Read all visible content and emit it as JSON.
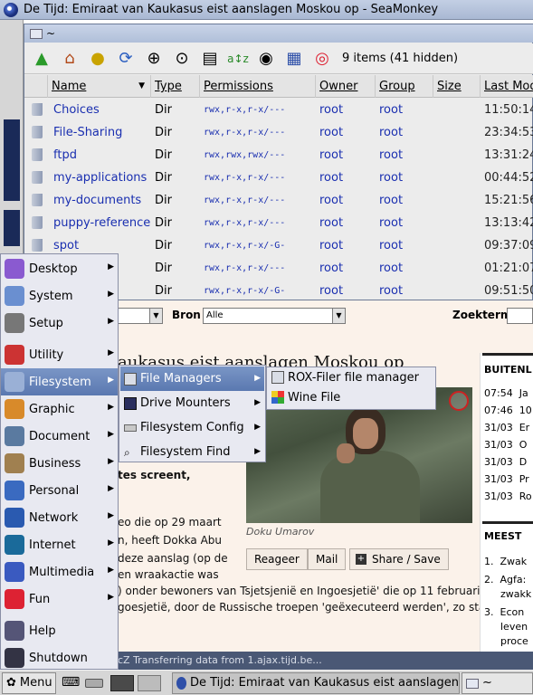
{
  "browser": {
    "title": "De Tijd: Emiraat van Kaukasus eist aanslagen Moskou op - SeaMonkey",
    "filter": {
      "bron_label": "Bron",
      "bron_value": "Alle",
      "zoekterm_label": "Zoekterm"
    },
    "article": {
      "headline": "aukasus eist aanslagen Moskou op",
      "lines": [
        "n, heeft Dokka Abu",
        "tes screent,",
        "eo die op 29 maart",
        "n, heeft Dokka Abu",
        "deze aanslag (op de",
        "en wraakactie was",
        ") onder bewoners van Tsjetsjenië en Ingoesjetië' die op 11 februari bij",
        "goesjetië, door de Russische troepen 'geëxecuteerd werden', zo staat"
      ],
      "caption": "Doku Umarov",
      "buttons": {
        "reageer": "Reageer",
        "mail": "Mail",
        "share": "Share / Save"
      }
    },
    "sidebar": {
      "header1": "BUITENL",
      "items": [
        {
          "time": "07:54",
          "text": "Ja"
        },
        {
          "time": "07:46",
          "text": "10"
        },
        {
          "time": "31/03",
          "text": "Er"
        },
        {
          "time": "31/03",
          "text": "O"
        },
        {
          "time": "31/03",
          "text": "D"
        },
        {
          "time": "31/03",
          "text": "Pr"
        },
        {
          "time": "31/03",
          "text": "Ro"
        }
      ],
      "header2": "MEEST",
      "list": [
        {
          "n": "1.",
          "text": "Zwak"
        },
        {
          "n": "2.",
          "text": "Agfa:"
        },
        {
          "n": "",
          "text": "zwakk"
        },
        {
          "n": "3.",
          "text": "Econ"
        },
        {
          "n": "",
          "text": "leven"
        },
        {
          "n": "",
          "text": "proce"
        }
      ]
    },
    "status": "cZ   Transferring data from 1.ajax.tijd.be..."
  },
  "rox": {
    "title": "~",
    "count": "9 items (41 hidden)",
    "columns": [
      "Name",
      "Type",
      "Permissions",
      "Owner",
      "Group",
      "Size",
      "Last Mod"
    ],
    "rows": [
      {
        "name": "Choices",
        "type": "Dir",
        "perm": "rwx,r-x,r-x/---",
        "owner": "root",
        "group": "root",
        "time": "11:50:14"
      },
      {
        "name": "File-Sharing",
        "type": "Dir",
        "perm": "rwx,r-x,r-x/---",
        "owner": "root",
        "group": "root",
        "time": "23:34:53"
      },
      {
        "name": "ftpd",
        "type": "Dir",
        "perm": "rwx,rwx,rwx/---",
        "owner": "root",
        "group": "root",
        "time": "13:31:24"
      },
      {
        "name": "my-applications",
        "type": "Dir",
        "perm": "rwx,r-x,r-x/---",
        "owner": "root",
        "group": "root",
        "time": "00:44:52"
      },
      {
        "name": "my-documents",
        "type": "Dir",
        "perm": "rwx,r-x,r-x/---",
        "owner": "root",
        "group": "root",
        "time": "15:21:56"
      },
      {
        "name": "puppy-reference",
        "type": "Dir",
        "perm": "rwx,r-x,r-x/---",
        "owner": "root",
        "group": "root",
        "time": "13:13:42"
      },
      {
        "name": "spot",
        "type": "Dir",
        "perm": "rwx,r-x,r-x/-G-",
        "owner": "root",
        "group": "root",
        "time": "09:37:09"
      },
      {
        "name": "",
        "type": "Dir",
        "perm": "rwx,r-x,r-x/---",
        "owner": "root",
        "group": "root",
        "time": "01:21:07"
      },
      {
        "name": "",
        "type": "Dir",
        "perm": "rwx,r-x,r-x/-G-",
        "owner": "root",
        "group": "root",
        "time": "09:51:50"
      }
    ]
  },
  "menu": {
    "items": [
      "Desktop",
      "System",
      "Setup",
      "Utility",
      "Filesystem",
      "Graphic",
      "Document",
      "Business",
      "Personal",
      "Network",
      "Internet",
      "Multimedia",
      "Fun",
      "Help",
      "Shutdown"
    ],
    "filesystem_sub": [
      "File Managers",
      "Drive Mounters",
      "Filesystem Config",
      "Filesystem Find"
    ],
    "file_managers_sub": [
      "ROX-Filer file manager",
      "Wine File"
    ]
  },
  "taskbar": {
    "menu_label": "Menu",
    "window1": "De Tijd: Emiraat van Kaukasus eist aanslagen",
    "window2": "~"
  }
}
